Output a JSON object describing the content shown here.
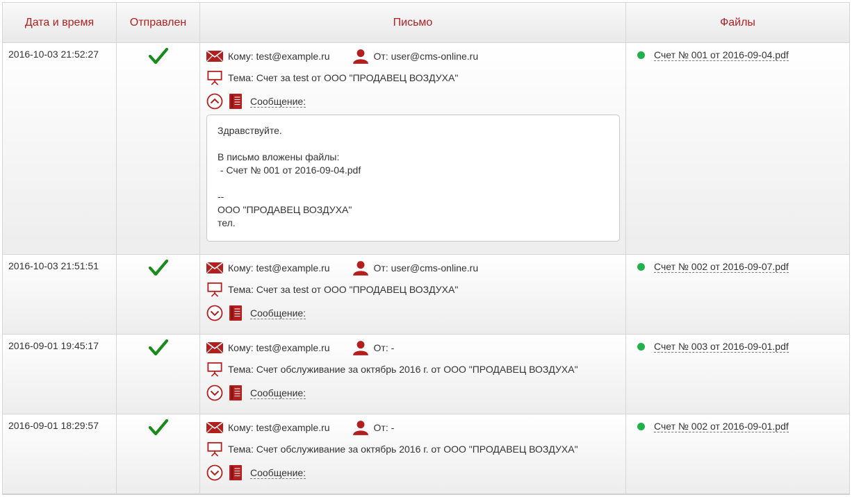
{
  "header": {
    "col_date": "Дата и время",
    "col_sent": "Отправлен",
    "col_letter": "Письмо",
    "col_files": "Файлы"
  },
  "colors": {
    "accent": "#b21f1f",
    "check": "#1a8a1a",
    "file_dot": "#22b24c"
  },
  "rows": [
    {
      "date": "2016-10-03 21:52:27",
      "sent": "check-icon",
      "to": "Кому: test@example.ru",
      "from": "От: user@cms-online.ru",
      "subject": "Тема: Счет за test от ООО \"ПРОДАВЕЦ ВОЗДУХА\"",
      "message_label": "Сообщение:",
      "expanded": true,
      "message_lines": [
        "Здравствуйте.",
        "",
        "В письмо вложены файлы:",
        " - Счет № 001 от 2016-09-04.pdf",
        "",
        "--",
        "ООО \"ПРОДАВЕЦ ВОЗДУХА\"",
        "тел."
      ],
      "file": "Счет № 001 от 2016-09-04.pdf"
    },
    {
      "date": "2016-10-03 21:51:51",
      "sent": "check-icon",
      "to": "Кому: test@example.ru",
      "from": "От: user@cms-online.ru",
      "subject": "Тема: Счет за test от ООО \"ПРОДАВЕЦ ВОЗДУХА\"",
      "message_label": "Сообщение:",
      "expanded": false,
      "file": "Счет № 002 от 2016-09-07.pdf"
    },
    {
      "date": "2016-09-01 19:45:17",
      "sent": "check-icon",
      "to": "Кому: test@example.ru",
      "from": "От: -",
      "subject": "Тема: Счет обслуживание за октябрь 2016 г. от ООО \"ПРОДАВЕЦ ВОЗДУХА\"",
      "message_label": "Сообщение:",
      "expanded": false,
      "file": "Счет № 003 от 2016-09-01.pdf"
    },
    {
      "date": "2016-09-01 18:29:57",
      "sent": "check-icon",
      "to": "Кому: test@example.ru",
      "from": "От: -",
      "subject": "Тема: Счет обслуживание за октябрь 2016 г. от ООО \"ПРОДАВЕЦ ВОЗДУХА\"",
      "message_label": "Сообщение:",
      "expanded": false,
      "file": "Счет № 002 от 2016-09-01.pdf"
    }
  ]
}
